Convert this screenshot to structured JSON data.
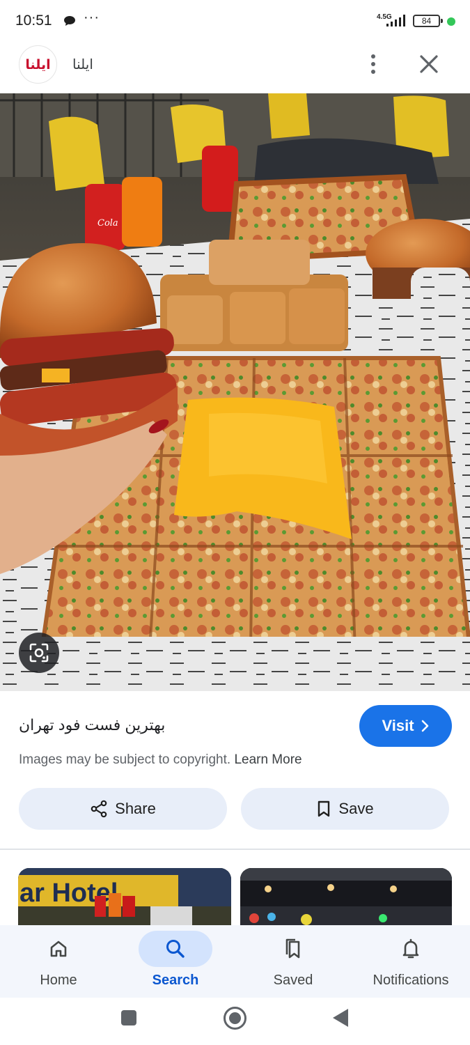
{
  "status_bar": {
    "time": "10:51",
    "more": "···",
    "network": "4.5G",
    "battery": "84"
  },
  "header": {
    "avatar_text": "ایلنا",
    "source_name": "ایلنا",
    "menu_icon": "more-vert-icon",
    "close_icon": "close-icon"
  },
  "image": {
    "lens_icon": "google-lens-icon"
  },
  "info": {
    "title": "بهترین فست فود تهران",
    "visit_label": "Visit",
    "copyright_text": "Images may be subject to copyright.",
    "learn_more": "Learn More",
    "share_label": "Share",
    "save_label": "Save"
  },
  "bottom_nav": {
    "items": [
      {
        "label": "Home",
        "icon": "home-icon",
        "active": false
      },
      {
        "label": "Search",
        "icon": "search-icon",
        "active": true
      },
      {
        "label": "Saved",
        "icon": "bookmarks-icon",
        "active": false
      },
      {
        "label": "Notifications",
        "icon": "bell-icon",
        "active": false
      }
    ]
  },
  "colors": {
    "accent": "#1a73e8",
    "active_nav": "#0b57d0",
    "active_pill": "#d3e3fd",
    "button_bg": "#e8eef9"
  }
}
